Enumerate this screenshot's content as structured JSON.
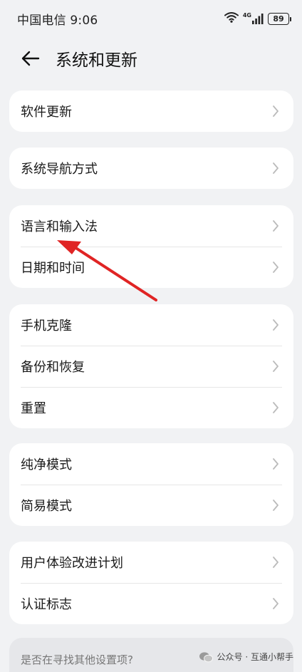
{
  "status_bar": {
    "carrier_time": "中国电信 9:06",
    "network_type": "4G",
    "battery_level": "89"
  },
  "header": {
    "title": "系统和更新"
  },
  "groups": [
    {
      "items": [
        {
          "label": "软件更新"
        }
      ]
    },
    {
      "items": [
        {
          "label": "系统导航方式"
        }
      ]
    },
    {
      "items": [
        {
          "label": "语言和输入法"
        },
        {
          "label": "日期和时间"
        }
      ]
    },
    {
      "items": [
        {
          "label": "手机克隆"
        },
        {
          "label": "备份和恢复"
        },
        {
          "label": "重置"
        }
      ]
    },
    {
      "items": [
        {
          "label": "纯净模式"
        },
        {
          "label": "简易模式"
        }
      ]
    },
    {
      "items": [
        {
          "label": "用户体验改进计划"
        },
        {
          "label": "认证标志"
        }
      ]
    }
  ],
  "suggestion": {
    "text": "是否在寻找其他设置项?"
  },
  "watermark": {
    "text": "公众号 · 互通小帮手"
  },
  "colors": {
    "background": "#f1f2f4",
    "card": "#ffffff",
    "annotation_arrow": "#e02424"
  }
}
